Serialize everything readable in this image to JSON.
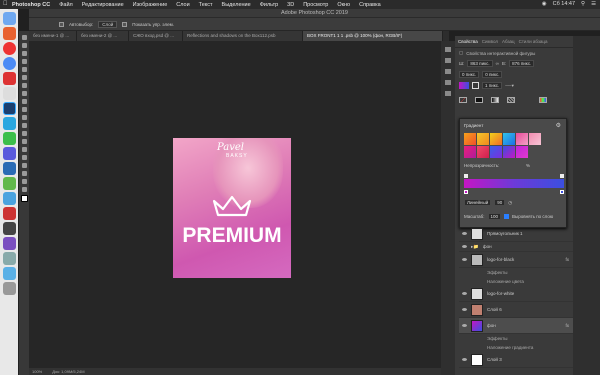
{
  "menubar": {
    "items": [
      "Photoshop CC",
      "Файл",
      "Редактирование",
      "Изображение",
      "Слои",
      "Текст",
      "Выделение",
      "Фильтр",
      "3D",
      "Просмотр",
      "Окно",
      "Справка"
    ],
    "right": [
      "Сб 14:47"
    ]
  },
  "window": {
    "title": "Adobe Photoshop CC 2019"
  },
  "options": {
    "auto_select_label": "Автовыбор:",
    "auto_select_value": "Слой",
    "show_controls_label": "Показать упр. элем."
  },
  "tabs": [
    {
      "label": "без имени-1 @ ..."
    },
    {
      "label": "без имени-2 @ ..."
    },
    {
      "label": "СЖО вход.psd @ ..."
    },
    {
      "label": "Reflections and shadows on the Box112.psb"
    },
    {
      "label": "BOX FRONT1 1 1 .psb @ 100% (фон, RGB/8*)",
      "active": true
    }
  ],
  "document": {
    "brand_script": "Pavel",
    "brand_sub": "BAKSY",
    "headline": "PREMIUM"
  },
  "status": {
    "zoom": "100%",
    "doc": "Док: 1,09М/5,24М"
  },
  "panel": {
    "tabs": [
      "Свойства",
      "Символ",
      "Абзац",
      "Стили абзаца"
    ],
    "section_title": "Свойства интерактивной фигуры",
    "w_label": "Ш:",
    "w_value": "863 пикс.",
    "h_label": "В:",
    "h_value": "876 пикс.",
    "x_value": "0 пикс.",
    "y_value": "0 пикс.",
    "stroke_value": "1 пикс."
  },
  "gradient_popup": {
    "header": "Градиент",
    "opacity_label": "Непрозрачность:",
    "opacity_unit": "%",
    "style_value": "Линейный",
    "angle_value": "90",
    "scale_label": "Масштаб:",
    "scale_value": "100",
    "align_label": "Выровнять по слою"
  },
  "layers": [
    {
      "name": "Прямоугольник 1",
      "type": "layer"
    },
    {
      "name": "фон",
      "type": "group"
    },
    {
      "name": "logo-for-black",
      "type": "layer",
      "fx": "fx"
    },
    {
      "name": "Эффекты",
      "type": "sub"
    },
    {
      "name": "Наложение цвета",
      "type": "sub"
    },
    {
      "name": "logo-for-white",
      "type": "layer"
    },
    {
      "name": "Слой 6",
      "type": "layer"
    },
    {
      "name": "фон",
      "type": "layer",
      "fx": "fx",
      "selected": true
    },
    {
      "name": "Эффекты",
      "type": "sub"
    },
    {
      "name": "Наложение градиента",
      "type": "sub"
    },
    {
      "name": "Слой 3",
      "type": "layer"
    }
  ],
  "colors": {
    "gradient_start": "#c416c4",
    "gradient_end": "#3b4fe0",
    "doc_pink": "#d56ac0"
  }
}
